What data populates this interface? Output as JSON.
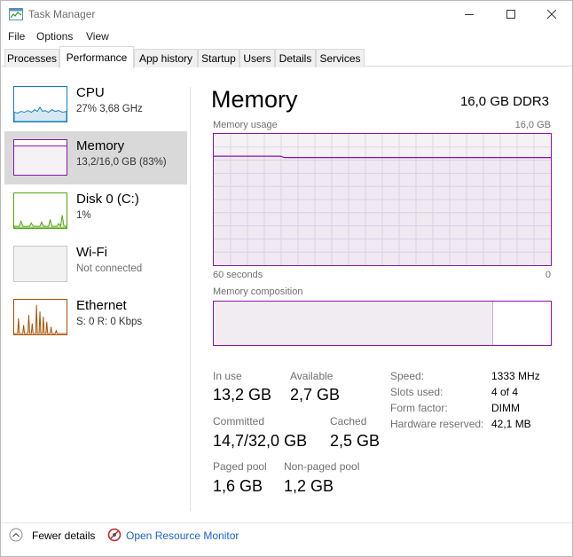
{
  "window": {
    "title": "Task Manager"
  },
  "menu": [
    "File",
    "Options",
    "View"
  ],
  "tabs": [
    {
      "label": "Processes",
      "active": false
    },
    {
      "label": "Performance",
      "active": true
    },
    {
      "label": "App history",
      "active": false
    },
    {
      "label": "Startup",
      "active": false
    },
    {
      "label": "Users",
      "active": false
    },
    {
      "label": "Details",
      "active": false
    },
    {
      "label": "Services",
      "active": false
    }
  ],
  "sidebar": {
    "items": [
      {
        "title": "CPU",
        "subtitle": "27%  3,68 GHz",
        "color": "#117dbb",
        "icon": "cpu-graph-thumbnail"
      },
      {
        "title": "Memory",
        "subtitle": "13,2/16,0 GB (83%)",
        "color": "#8b12ae",
        "icon": "memory-graph-thumbnail",
        "selected": true
      },
      {
        "title": "Disk 0 (C:)",
        "subtitle": "1%",
        "color": "#4da60c",
        "icon": "disk-graph-thumbnail"
      },
      {
        "title": "Wi-Fi",
        "subtitle": "Not connected",
        "color": "#a0a0a0",
        "icon": "wifi-graph-thumbnail"
      },
      {
        "title": "Ethernet",
        "subtitle": "S: 0  R: 0 Kbps",
        "color": "#a74f01",
        "icon": "ethernet-graph-thumbnail"
      }
    ]
  },
  "main": {
    "title": "Memory",
    "capacity": "16,0 GB DDR3",
    "usage_label": "Memory usage",
    "usage_max": "16,0 GB",
    "time_span": "60 seconds",
    "time_end": "0",
    "composition_label": "Memory composition",
    "usage_percent": 83,
    "in_use_fraction": 0.83,
    "stats": {
      "in_use_label": "In use",
      "in_use_value": "13,2 GB",
      "available_label": "Available",
      "available_value": "2,7 GB",
      "committed_label": "Committed",
      "committed_value": "14,7/32,0 GB",
      "cached_label": "Cached",
      "cached_value": "2,5 GB",
      "paged_label": "Paged pool",
      "paged_value": "1,6 GB",
      "nonpaged_label": "Non-paged pool",
      "nonpaged_value": "1,2 GB"
    },
    "specs": [
      {
        "label": "Speed:",
        "value": "1333 MHz"
      },
      {
        "label": "Slots used:",
        "value": "4 of 4"
      },
      {
        "label": "Form factor:",
        "value": "DIMM"
      },
      {
        "label": "Hardware reserved:",
        "value": "42,1 MB"
      }
    ]
  },
  "footer": {
    "fewer_details": "Fewer details",
    "resource_monitor": "Open Resource Monitor"
  },
  "colors": {
    "memory_accent": "#8b12ae",
    "link": "#1a64c8"
  }
}
